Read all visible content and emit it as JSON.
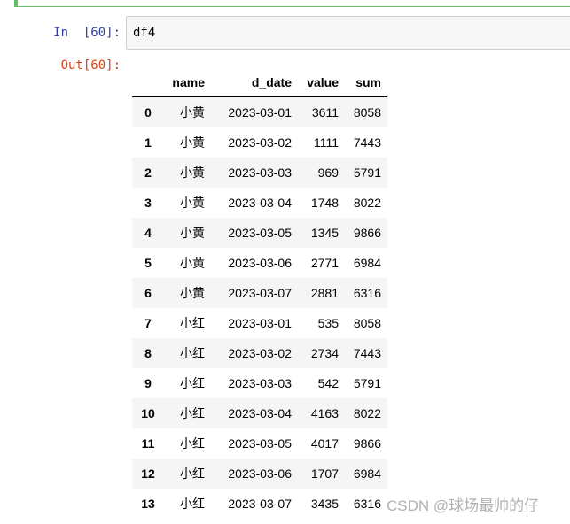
{
  "cell": {
    "in_prompt": "In  [60]:",
    "source": "df4",
    "out_prompt": "Out[60]:"
  },
  "table": {
    "columns": [
      "",
      "name",
      "d_date",
      "value",
      "sum"
    ],
    "rows": [
      {
        "index": "0",
        "name": "小黄",
        "d_date": "2023-03-01",
        "value": "3611",
        "sum": "8058"
      },
      {
        "index": "1",
        "name": "小黄",
        "d_date": "2023-03-02",
        "value": "1111",
        "sum": "7443"
      },
      {
        "index": "2",
        "name": "小黄",
        "d_date": "2023-03-03",
        "value": "969",
        "sum": "5791"
      },
      {
        "index": "3",
        "name": "小黄",
        "d_date": "2023-03-04",
        "value": "1748",
        "sum": "8022"
      },
      {
        "index": "4",
        "name": "小黄",
        "d_date": "2023-03-05",
        "value": "1345",
        "sum": "9866"
      },
      {
        "index": "5",
        "name": "小黄",
        "d_date": "2023-03-06",
        "value": "2771",
        "sum": "6984"
      },
      {
        "index": "6",
        "name": "小黄",
        "d_date": "2023-03-07",
        "value": "2881",
        "sum": "6316"
      },
      {
        "index": "7",
        "name": "小红",
        "d_date": "2023-03-01",
        "value": "535",
        "sum": "8058"
      },
      {
        "index": "8",
        "name": "小红",
        "d_date": "2023-03-02",
        "value": "2734",
        "sum": "7443"
      },
      {
        "index": "9",
        "name": "小红",
        "d_date": "2023-03-03",
        "value": "542",
        "sum": "5791"
      },
      {
        "index": "10",
        "name": "小红",
        "d_date": "2023-03-04",
        "value": "4163",
        "sum": "8022"
      },
      {
        "index": "11",
        "name": "小红",
        "d_date": "2023-03-05",
        "value": "4017",
        "sum": "9866"
      },
      {
        "index": "12",
        "name": "小红",
        "d_date": "2023-03-06",
        "value": "1707",
        "sum": "6984"
      },
      {
        "index": "13",
        "name": "小红",
        "d_date": "2023-03-07",
        "value": "3435",
        "sum": "6316"
      }
    ]
  },
  "watermark": "CSDN @球场最帅的仔",
  "colors": {
    "in_prompt": "#303f9f",
    "out_prompt": "#d84315",
    "cell_border_active": "#66bb6a",
    "stripe": "#f5f5f5"
  }
}
